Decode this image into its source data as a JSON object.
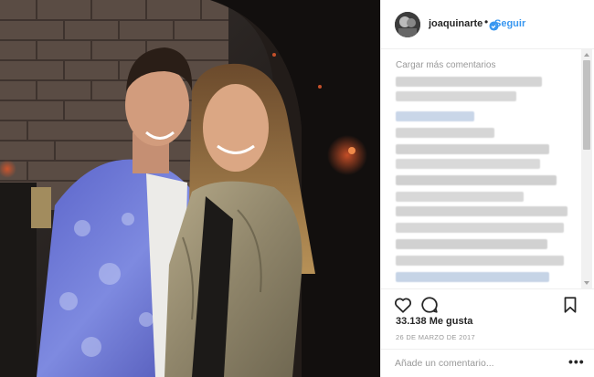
{
  "post": {
    "username": "joaquinarte",
    "dot": "•",
    "follow_label": "Seguir"
  },
  "comments": {
    "load_more": "Cargar más comentarios"
  },
  "stats": {
    "likes": "33.138 Me gusta",
    "date": "26 DE MARZO DE 2017"
  },
  "comment_box": {
    "placeholder": "Añade un comentario...",
    "more": "•••"
  },
  "colors": {
    "accent": "#3897f0",
    "text": "#262626",
    "muted": "#999999",
    "divider": "#efefef"
  },
  "icons": [
    "verified-badge-icon",
    "heart-icon",
    "comment-icon",
    "bookmark-icon",
    "more-options-icon",
    "scroll-up-icon",
    "scroll-down-icon"
  ]
}
